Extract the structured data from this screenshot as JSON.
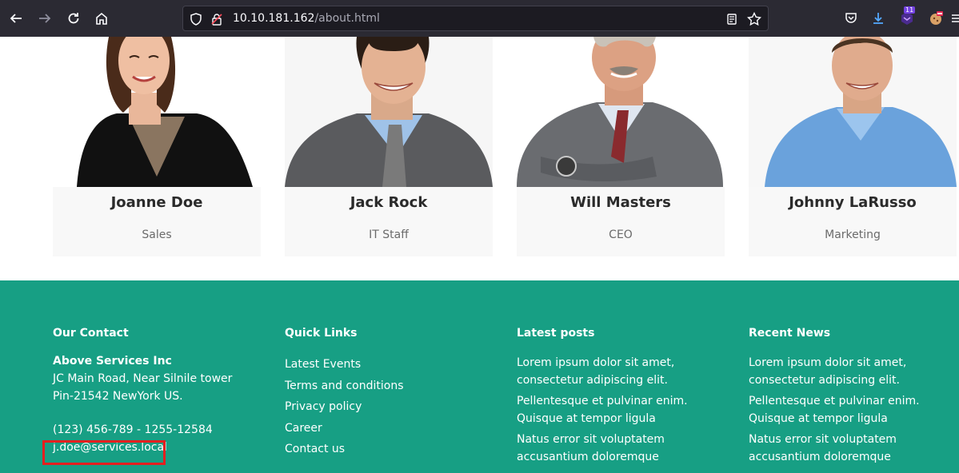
{
  "browser": {
    "url_host": "10.10.181.162",
    "url_path": "/about.html",
    "extension_badge": "11"
  },
  "team": [
    {
      "name": "Joanne Doe",
      "role": "Sales"
    },
    {
      "name": "Jack Rock",
      "role": "IT Staff"
    },
    {
      "name": "Will Masters",
      "role": "CEO"
    },
    {
      "name": "Johnny LaRusso",
      "role": "Marketing"
    }
  ],
  "footer": {
    "contact": {
      "heading": "Our Contact",
      "company": "Above Services Inc",
      "address_line1": "JC Main Road, Near Silnile tower",
      "address_line2": "Pin-21542 NewYork US.",
      "phone": "(123) 456-789 - 1255-12584",
      "email": "j.doe@services.local"
    },
    "quick_links": {
      "heading": "Quick Links",
      "items": [
        "Latest Events",
        "Terms and conditions",
        "Privacy policy",
        "Career",
        "Contact us"
      ]
    },
    "latest_posts": {
      "heading": "Latest posts",
      "items": [
        "Lorem ipsum dolor sit amet, consectetur adipiscing elit.",
        "Pellentesque et pulvinar enim. Quisque at tempor ligula",
        "Natus error sit voluptatem accusantium doloremque"
      ]
    },
    "recent_news": {
      "heading": "Recent News",
      "items": [
        "Lorem ipsum dolor sit amet, consectetur adipiscing elit.",
        "Pellentesque et pulvinar enim. Quisque at tempor ligula",
        "Natus error sit voluptatem accusantium doloremque"
      ]
    }
  },
  "colors": {
    "footer_bg": "#179f84",
    "toolbar_bg": "#2b2a33",
    "highlight": "#e41f1f"
  }
}
